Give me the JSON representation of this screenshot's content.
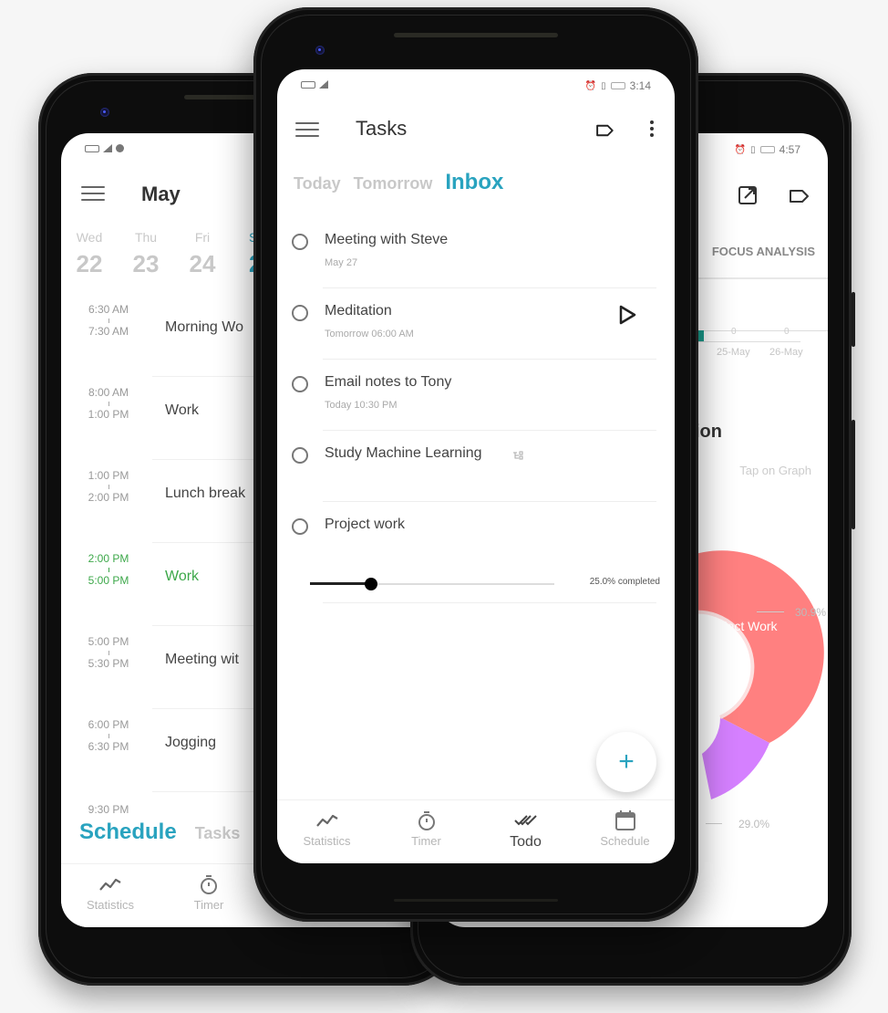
{
  "colors": {
    "accent": "#29a3bf",
    "highlight_green": "#3da84a",
    "pie_project_work": "#ff8080",
    "pie_second": "#d580ff",
    "bar_teal": "#1a9c8c"
  },
  "center_phone": {
    "status_bar": {
      "time": "3:14"
    },
    "header": {
      "title": "Tasks",
      "menu_icon": "hamburger-icon",
      "label_icon": "label-icon",
      "more_icon": "more-vert-icon"
    },
    "tabs": [
      {
        "label": "Today",
        "active": false
      },
      {
        "label": "Tomorrow",
        "active": false
      },
      {
        "label": "Inbox",
        "active": true
      }
    ],
    "tasks": [
      {
        "name": "Meeting with Steve",
        "subtitle": "May 27"
      },
      {
        "name": "Meditation",
        "subtitle": "Tomorrow 06:00 AM",
        "action_icon": "play-icon"
      },
      {
        "name": "Email notes to Tony",
        "subtitle": "Today 10:30 PM"
      },
      {
        "name": "Study Machine Learning",
        "subtitle": "",
        "badge_icon": "subtasks-icon"
      },
      {
        "name": "Project work",
        "subtitle": "",
        "progress_percent": 25.0,
        "progress_label": "25.0% completed"
      }
    ],
    "fab": {
      "label": "+",
      "icon": "add-icon"
    },
    "bottom_nav": [
      {
        "label": "Statistics",
        "icon": "statistics-icon",
        "active": false
      },
      {
        "label": "Timer",
        "icon": "timer-icon",
        "active": false
      },
      {
        "label": "Todo",
        "icon": "todo-icon",
        "active": true
      },
      {
        "label": "Schedule",
        "icon": "calendar-icon",
        "active": false
      }
    ]
  },
  "left_phone": {
    "header": {
      "title": "May"
    },
    "days": [
      {
        "name": "Wed",
        "date": "22"
      },
      {
        "name": "Thu",
        "date": "23"
      },
      {
        "name": "Fri",
        "date": "24"
      },
      {
        "name": "S",
        "date": "2",
        "selected": true
      }
    ],
    "schedule": [
      {
        "start": "6:30 AM",
        "end": "7:30 AM",
        "title": "Morning Wo"
      },
      {
        "start": "8:00 AM",
        "end": "1:00 PM",
        "title": "Work"
      },
      {
        "start": "1:00 PM",
        "end": "2:00 PM",
        "title": "Lunch break"
      },
      {
        "start": "2:00 PM",
        "end": "5:00 PM",
        "title": "Work",
        "current": true
      },
      {
        "start": "5:00 PM",
        "end": "5:30 PM",
        "title": "Meeting wit"
      },
      {
        "start": "6:00 PM",
        "end": "6:30 PM",
        "title": "Jogging"
      }
    ],
    "last_time": "9:30 PM",
    "tabs": [
      {
        "label": "Schedule",
        "active": true
      },
      {
        "label": "Tasks",
        "active": false
      }
    ],
    "bottom_nav": [
      {
        "label": "Statistics",
        "icon": "statistics-icon"
      },
      {
        "label": "Timer",
        "icon": "timer-icon"
      }
    ]
  },
  "right_phone": {
    "status_bar": {
      "time": "4:57"
    },
    "tab_label": "FOCUS ANALYSIS",
    "bar_chart": {
      "x_labels": [
        "25-May",
        "26-May"
      ],
      "values": [
        "0",
        "0"
      ]
    },
    "section_heading": "ion",
    "hint": "Tap on Graph",
    "pie": {
      "slice_label": "roject Work",
      "percentages": [
        "30.9%",
        "29.0%"
      ]
    }
  }
}
